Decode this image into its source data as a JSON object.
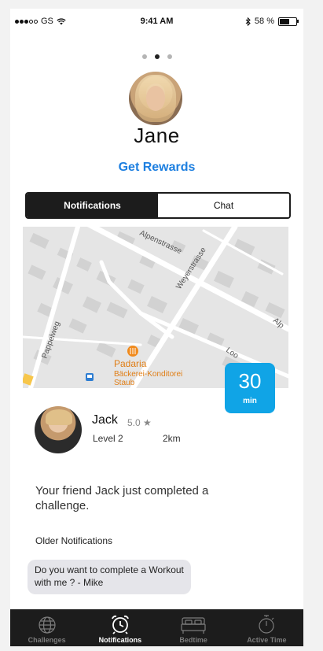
{
  "status_bar": {
    "carrier": "GS",
    "time": "9:41 AM",
    "battery_percent": "58 %",
    "battery_level": 0.58
  },
  "profile": {
    "name": "Jane",
    "rewards_link": "Get Rewards"
  },
  "segments": {
    "notifications": "Notifications",
    "chat": "Chat",
    "selected": "notifications"
  },
  "map": {
    "streets": [
      "Alpenstrasse",
      "Weyerstrasse",
      "Pappelweg",
      "Alp",
      "Loo"
    ],
    "poi_name": "Padaria",
    "poi_subtitle_line1": "Bäckerei-Konditorei",
    "poi_subtitle_line2": "Staub"
  },
  "time_badge": {
    "value": "30",
    "unit": "min"
  },
  "friend": {
    "name": "Jack",
    "rating": "5.0 ★",
    "level": "Level 2",
    "distance": "2km"
  },
  "notification": {
    "message": "Your friend Jack just completed a challenge."
  },
  "older": {
    "heading": "Older Notifications",
    "message": "Do you want to complete a Workout with me ? - Mike"
  },
  "tabs": [
    {
      "label": "Challenges",
      "icon": "globe-icon"
    },
    {
      "label": "Notifications",
      "icon": "alarm-clock-icon"
    },
    {
      "label": "Bedtime",
      "icon": "bed-icon"
    },
    {
      "label": "Active Time",
      "icon": "stopwatch-icon"
    }
  ],
  "active_tab": "Notifications"
}
